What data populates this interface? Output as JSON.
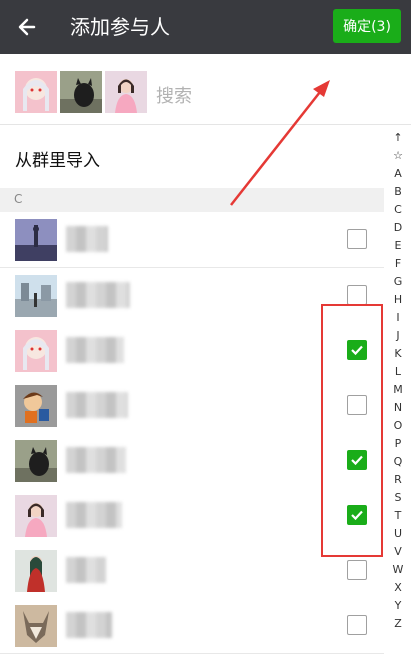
{
  "header": {
    "title": "添加参与人",
    "confirm_label": "确定(3)"
  },
  "search": {
    "placeholder": "搜索",
    "selected_avatars": [
      "anime-girl-avatar",
      "cat-avatar",
      "girl-photo-avatar"
    ]
  },
  "import_label": "从群里导入",
  "section_header": "C",
  "contacts": [
    {
      "avatar": "city-tower-avatar",
      "checked": false
    },
    {
      "avatar": "street-photo-avatar",
      "checked": false
    },
    {
      "avatar": "anime-girl-avatar",
      "checked": true
    },
    {
      "avatar": "cartoon-boy-avatar",
      "checked": false
    },
    {
      "avatar": "cat-avatar",
      "checked": true
    },
    {
      "avatar": "girl-photo-avatar",
      "checked": true
    },
    {
      "avatar": "red-dress-anime-avatar",
      "checked": false
    },
    {
      "avatar": "wolf-avatar",
      "checked": false
    }
  ],
  "index_letters": [
    "↑",
    "☆",
    "A",
    "B",
    "C",
    "D",
    "E",
    "F",
    "G",
    "H",
    "I",
    "J",
    "K",
    "L",
    "M",
    "N",
    "O",
    "P",
    "Q",
    "R",
    "S",
    "T",
    "U",
    "V",
    "W",
    "X",
    "Y",
    "Z"
  ],
  "colors": {
    "topbar": "#393a3f",
    "accent_green": "#1aad19",
    "annotation_red": "#e53935"
  }
}
